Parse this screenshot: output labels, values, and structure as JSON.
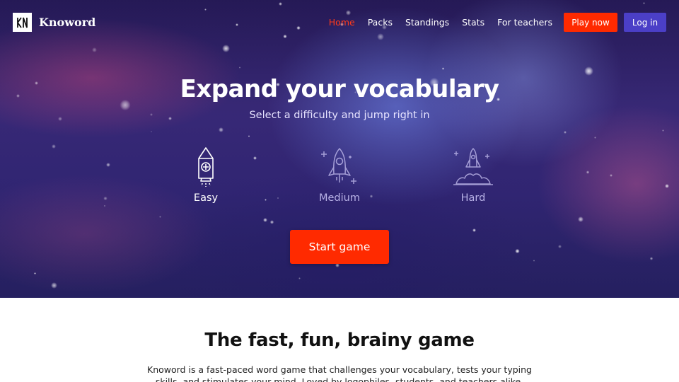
{
  "brand": {
    "name": "Knoword",
    "logo_glyph": "KN"
  },
  "nav": {
    "links": [
      "Home",
      "Packs",
      "Standings",
      "Stats",
      "For teachers"
    ],
    "active": "Home",
    "play_label": "Play now",
    "login_label": "Log in"
  },
  "hero": {
    "title": "Expand your vocabulary",
    "subtitle": "Select a difficulty and jump right in",
    "difficulties": [
      {
        "label": "Easy",
        "icon": "rocket-icon",
        "selected": true
      },
      {
        "label": "Medium",
        "icon": "rocket-sparkles-icon",
        "selected": false
      },
      {
        "label": "Hard",
        "icon": "rocket-launch-icon",
        "selected": false
      }
    ],
    "start_label": "Start game"
  },
  "about": {
    "title": "The fast, fun, brainy game",
    "body": "Knoword is a fast-paced word game that challenges your vocabulary, tests your typing skills, and stimulates your mind. Loved by logophiles, students, and teachers alike."
  },
  "colors": {
    "accent": "#ff2a00",
    "login": "#4b3fc7",
    "active_nav": "#ff3b1a",
    "hero_base": "#35287a"
  }
}
